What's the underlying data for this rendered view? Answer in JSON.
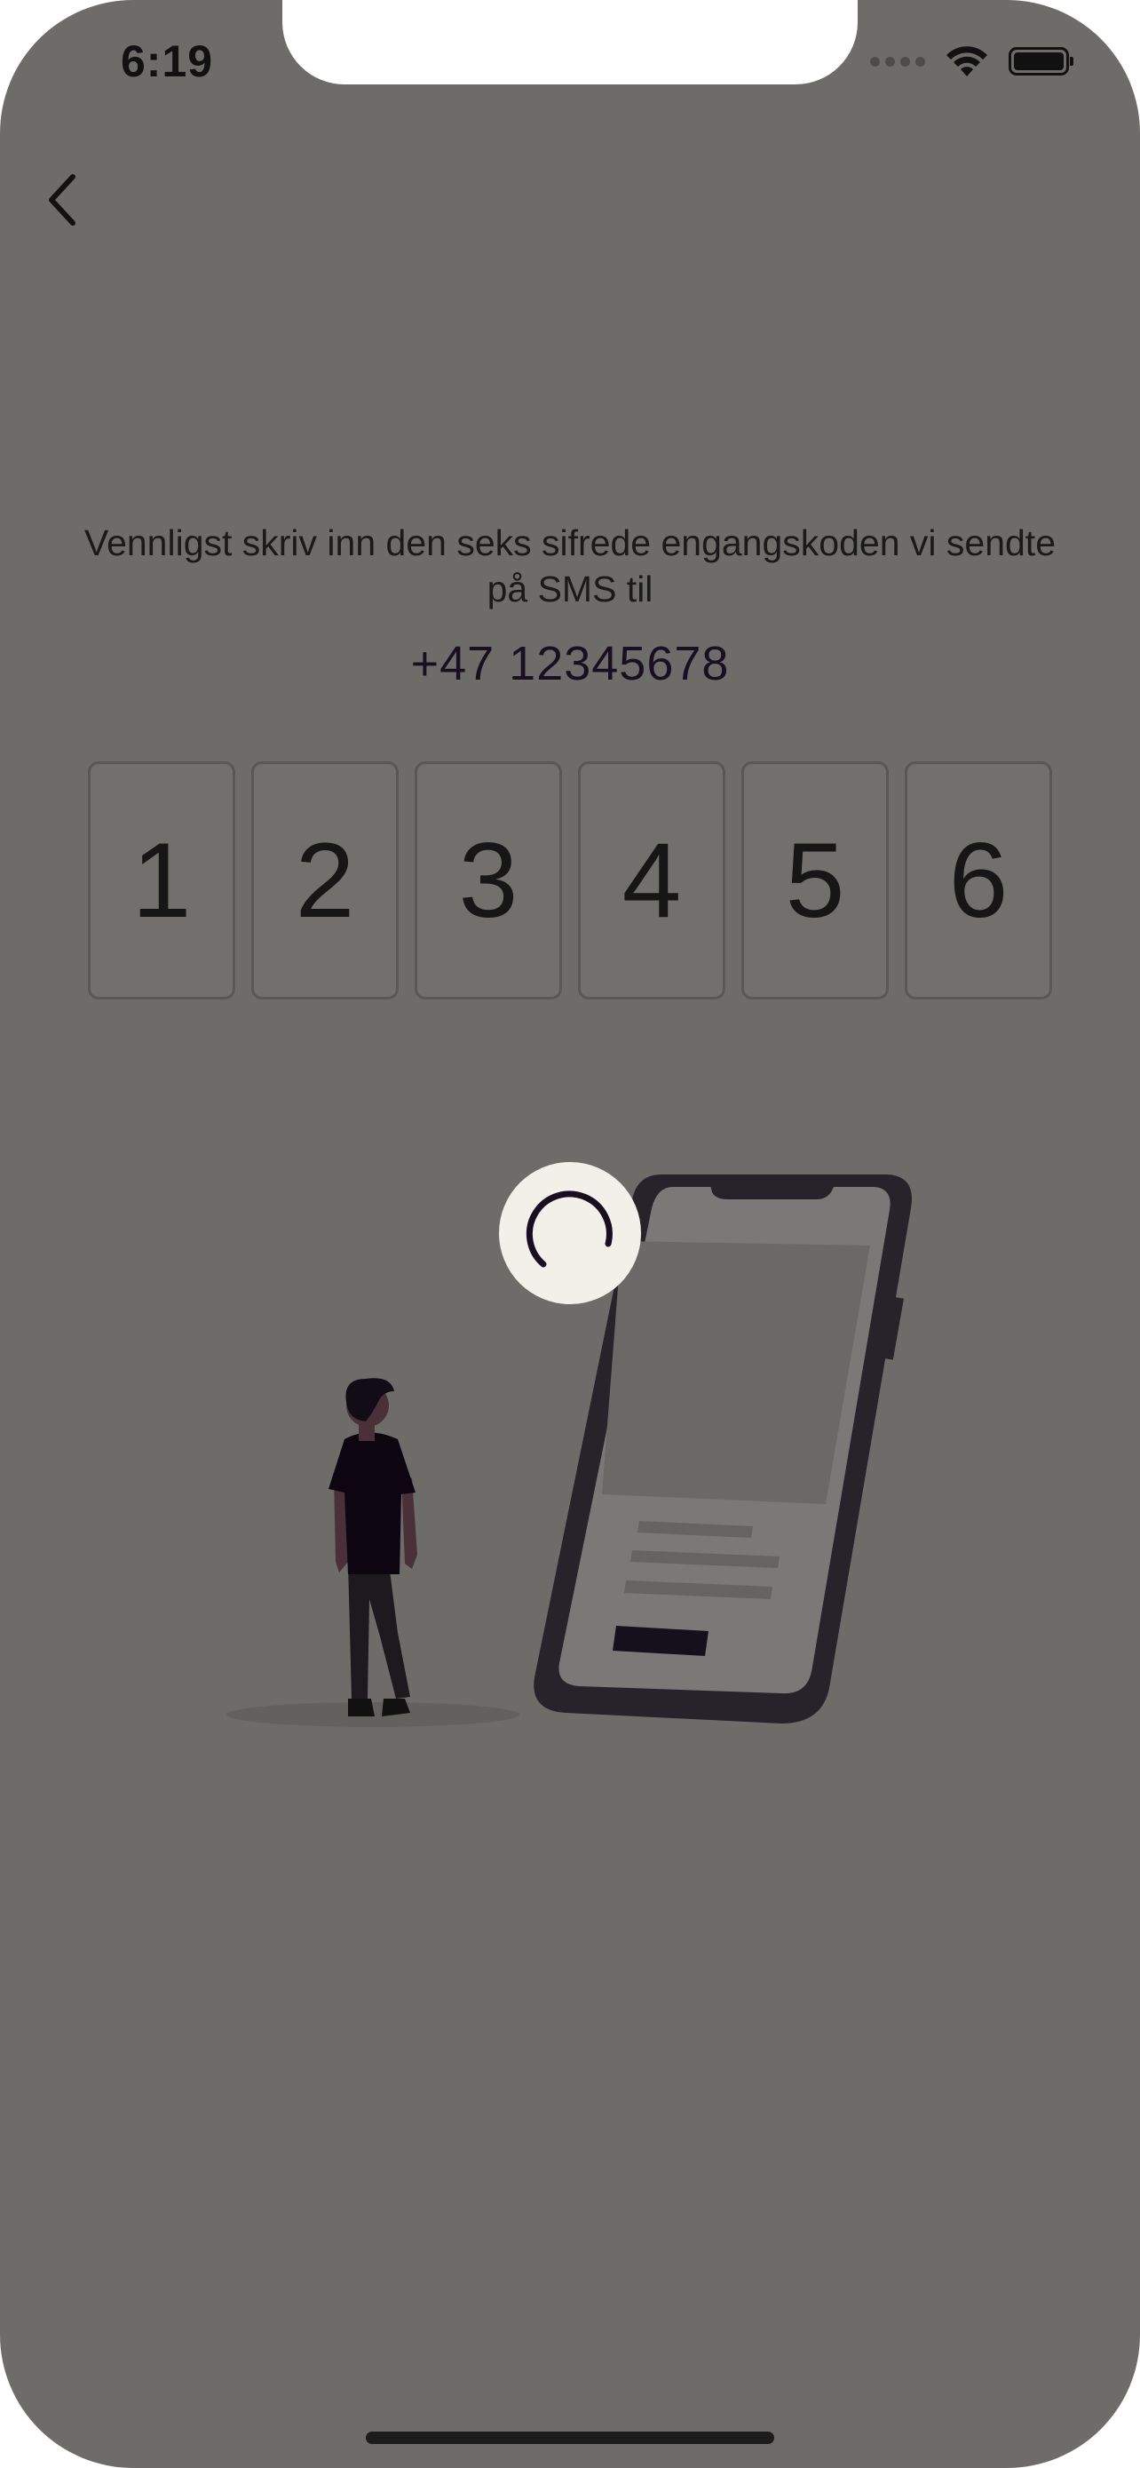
{
  "status_bar": {
    "time": "6:19"
  },
  "nav": {
    "back_icon": "chevron-left-icon"
  },
  "content": {
    "instruction": "Vennligst skriv inn den seks sifrede engangskoden vi sendte på SMS til",
    "phone_number": "+47 12345678",
    "code_digits": [
      "1",
      "2",
      "3",
      "4",
      "5",
      "6"
    ]
  },
  "icons": {
    "wifi": "wifi-icon",
    "battery": "battery-icon",
    "signal": "signal-icon",
    "spinner": "loading-spinner-icon"
  },
  "colors": {
    "overlay_background": "#6d6c69",
    "spinner_bubble": "#f3f0e9",
    "spinner_stroke": "#1a0f22",
    "phone_frame": "#26232b"
  }
}
